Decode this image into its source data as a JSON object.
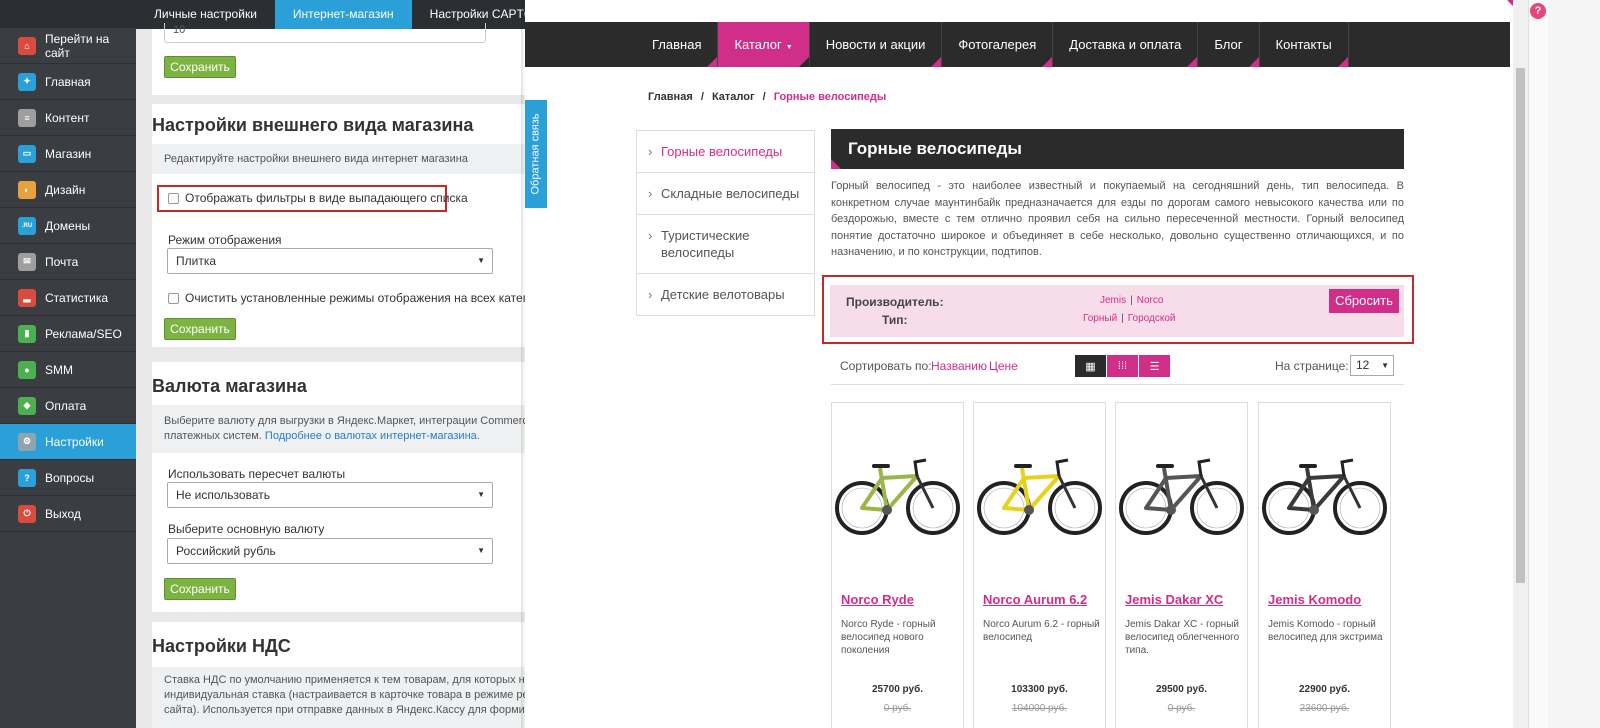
{
  "sidebar": {
    "items": [
      {
        "label": "Перейти на сайт",
        "icon": "home-icon",
        "color": "#d84b3f",
        "glyph": "⌂"
      },
      {
        "label": "Главная",
        "icon": "butterfly-icon",
        "color": "#2a9fd8",
        "glyph": "✦"
      },
      {
        "label": "Контент",
        "icon": "document-icon",
        "color": "#9e9e9e",
        "glyph": "≡"
      },
      {
        "label": "Магазин",
        "icon": "cart-icon",
        "color": "#2a9fd8",
        "glyph": "▭"
      },
      {
        "label": "Дизайн",
        "icon": "palette-icon",
        "color": "#e6a23c",
        "glyph": "◐"
      },
      {
        "label": "Домены",
        "icon": "domain-icon",
        "color": "#2a9fd8",
        "glyph": ".RU"
      },
      {
        "label": "Почта",
        "icon": "mail-icon",
        "color": "#9e9e9e",
        "glyph": "✉"
      },
      {
        "label": "Статистика",
        "icon": "stats-icon",
        "color": "#d84b3f",
        "glyph": "▂"
      },
      {
        "label": "Реклама/SEO",
        "icon": "chart-icon",
        "color": "#4caf50",
        "glyph": "▮"
      },
      {
        "label": "SMM",
        "icon": "people-icon",
        "color": "#4caf50",
        "glyph": "●"
      },
      {
        "label": "Оплата",
        "icon": "payment-icon",
        "color": "#4caf50",
        "glyph": "◆"
      },
      {
        "label": "Настройки",
        "icon": "gear-icon",
        "color": "#90a4ae",
        "glyph": "⚙",
        "active": true
      },
      {
        "label": "Вопросы",
        "icon": "question-icon",
        "color": "#2a9fd8",
        "glyph": "?"
      },
      {
        "label": "Выход",
        "icon": "power-icon",
        "color": "#d84b3f",
        "glyph": "⏻"
      }
    ]
  },
  "admin": {
    "tabs": [
      {
        "label": "Личные настройки"
      },
      {
        "label": "Интернет-магазин",
        "active": true
      },
      {
        "label": "Настройки CAPTCHA"
      }
    ],
    "top_field_value": "10",
    "save_label": "Сохранить",
    "appearance": {
      "title": "Настройки внешнего вида магазина",
      "desc": "Редактируйте настройки внешнего вида интернет магазина",
      "filters_checkbox": "Отображать фильтры в виде выпадающего списка",
      "mode_label": "Режим отображения",
      "mode_value": "Плитка",
      "clear_checkbox": "Очистить установленные режимы отображения на всех категориях"
    },
    "currency": {
      "title": "Валюта магазина",
      "desc_line1": "Выберите валюту для выгрузки в Яндекс.Маркет, интеграции CommerceM",
      "desc_line2": "платежных систем.",
      "desc_link": "Подробнее о валютах интернет-магазина.",
      "recalc_label": "Использовать пересчет валюты",
      "recalc_value": "Не использовать",
      "main_label": "Выберите основную валюту",
      "main_value": "Российский рубль"
    },
    "vat": {
      "title": "Настройки НДС",
      "line1": "Ставка НДС по умолчанию применяется к тем товарам, для которых не у",
      "line2": "индивидуальная ставка (настраивается в карточке товара в режиме ред",
      "line3": "сайта). Используется при отправке данных в Яндекс.Кассу для формиро"
    }
  },
  "site": {
    "feedback": "Обратная связь",
    "nav": [
      {
        "label": "Главная"
      },
      {
        "label": "Каталог",
        "active": true
      },
      {
        "label": "Новости и акции"
      },
      {
        "label": "Фотогалерея"
      },
      {
        "label": "Доставка и оплата"
      },
      {
        "label": "Блог"
      },
      {
        "label": "Контакты"
      }
    ],
    "breadcrumb": {
      "home": "Главная",
      "catalog": "Каталог",
      "current": "Горные велосипеды",
      "sep": "/"
    },
    "categories": [
      {
        "label": "Горные велосипеды",
        "active": true
      },
      {
        "label": "Складные велосипеды"
      },
      {
        "label": "Туристические велосипеды"
      },
      {
        "label": "Детские велотовары"
      }
    ],
    "title": "Горные велосипеды",
    "description": "Горный велосипед - это наиболее известный и покупаемый на сегодняшний день, тип велосипеда. В конкретном случае маунтинбайк предназначается для езды по дорогам самого невысокого качества или по бездорожью, вместе с тем отлично проявил себя на сильно пересеченной местности. Горный велосипед понятие достаточно широкое и объединяет в себе несколько, довольно существенно отличающихся, и по назначению, и по конструкции, подтипов.",
    "filters": {
      "maker_label": "Производитель:",
      "maker_values": [
        "Jemis",
        "Norco"
      ],
      "type_label": "Тип:",
      "type_values": [
        "Горный",
        "Городской"
      ],
      "reset": "Сбросить"
    },
    "sort": {
      "label": "Сортировать по:",
      "by_name": "Названию",
      "by_price": "Цене",
      "per_page_label": "На странице:",
      "per_page_value": "12"
    },
    "products": [
      {
        "name": "Norco Ryde",
        "desc": "Norco Ryde - горный велосипед нового поколения",
        "price": "25700 руб.",
        "old": "0 руб.",
        "frame": "#9bb54a"
      },
      {
        "name": "Norco Aurum 6.2",
        "desc": "Norco Aurum 6.2 - горный велосипед",
        "price": "103300 руб.",
        "old": "104000 руб.",
        "frame": "#e6d21a"
      },
      {
        "name": "Jemis Dakar XC",
        "desc": "Jemis Dakar XC - горный велосипед облегченного типа.",
        "price": "29500 руб.",
        "old": "0 руб.",
        "frame": "#555555"
      },
      {
        "name": "Jemis Komodo",
        "desc": "Jemis Komodo - горный велосипед для экстрима",
        "price": "22900 руб.",
        "old": "23600 руб.",
        "frame": "#3a3a3a"
      }
    ]
  },
  "colors": {
    "accent": "#d12e8a",
    "admin_blue": "#2a9fd8",
    "save_green": "#7cb342",
    "highlight": "#c62828"
  }
}
